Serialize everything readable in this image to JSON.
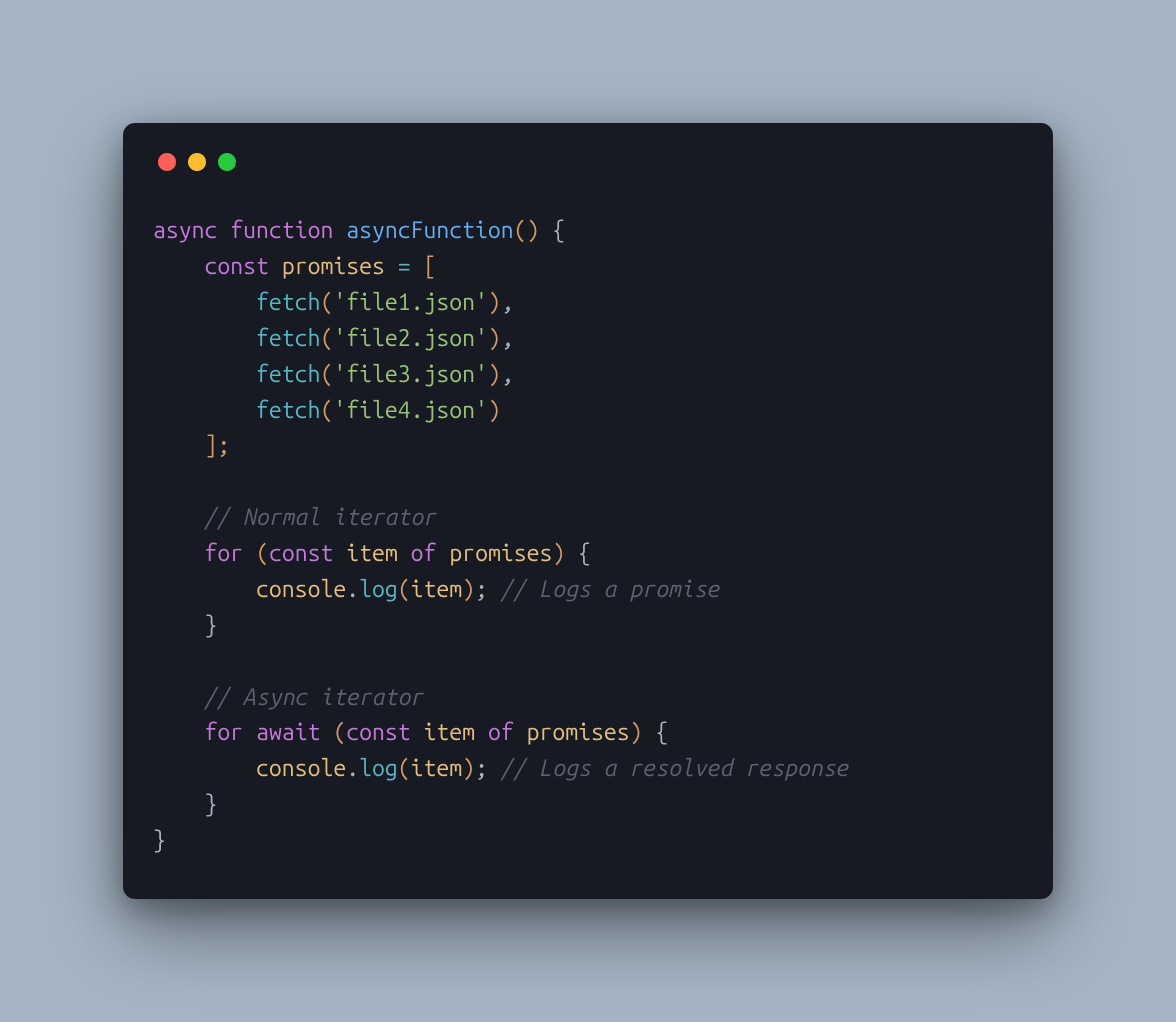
{
  "code": {
    "tokens": {
      "async": "async",
      "function": "function",
      "fn_name": "asyncFunction",
      "const": "const",
      "promises": "promises",
      "eq": "=",
      "open_bracket": "[",
      "fetch": "fetch",
      "file1": "'file1.json'",
      "file2": "'file2.json'",
      "file3": "'file3.json'",
      "file4": "'file4.json'",
      "close_bracket": "];",
      "comment_normal": "// Normal iterator",
      "for": "for",
      "item": "item",
      "of": "of",
      "open_brace": "{",
      "close_brace": "}",
      "console": "console",
      "dot": ".",
      "log": "log",
      "semicolon": ";",
      "comment_logs_promise": "// Logs a promise",
      "comment_async": "// Async iterator",
      "await": "await",
      "comment_logs_resolved": "// Logs a resolved response",
      "comma": ",",
      "open_paren": "(",
      "close_paren": ")",
      "empty_parens_open": "(",
      "empty_parens_close": ")"
    }
  }
}
